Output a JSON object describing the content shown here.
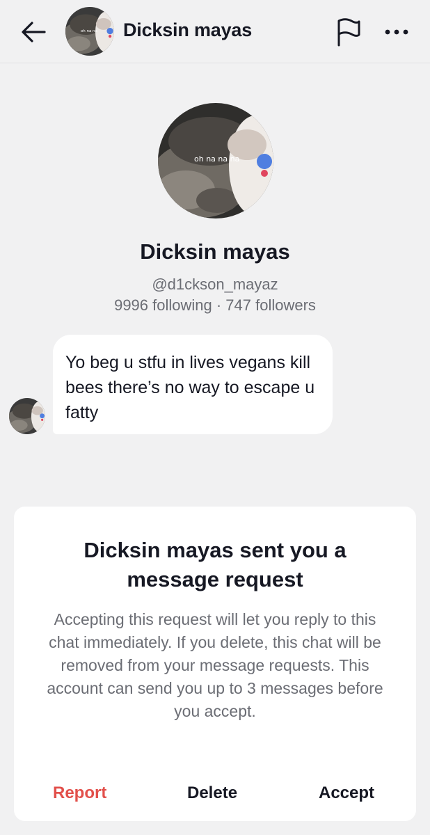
{
  "header": {
    "name": "Dicksin mayas",
    "avatar_caption": "oh na na"
  },
  "profile": {
    "name": "Dicksin mayas",
    "handle": "@d1ckson_mayaz",
    "stats": "9996 following · 747 followers",
    "avatar_caption": "oh na na na"
  },
  "message": {
    "text": "Yo beg u stfu in lives vegans kill bees there’s no way to escape u fatty"
  },
  "request": {
    "title": "Dicksin mayas sent you a message request",
    "body": "Accepting this request will let you reply to this chat immediately. If you delete, this chat will be removed from your message requests. This account can send you up to 3 messages before you accept.",
    "report_label": "Report",
    "delete_label": "Delete",
    "accept_label": "Accept"
  },
  "colors": {
    "background": "#f1f1f2",
    "report": "#e2504b",
    "primary_text": "#161823",
    "secondary_text": "#6b6d74"
  }
}
